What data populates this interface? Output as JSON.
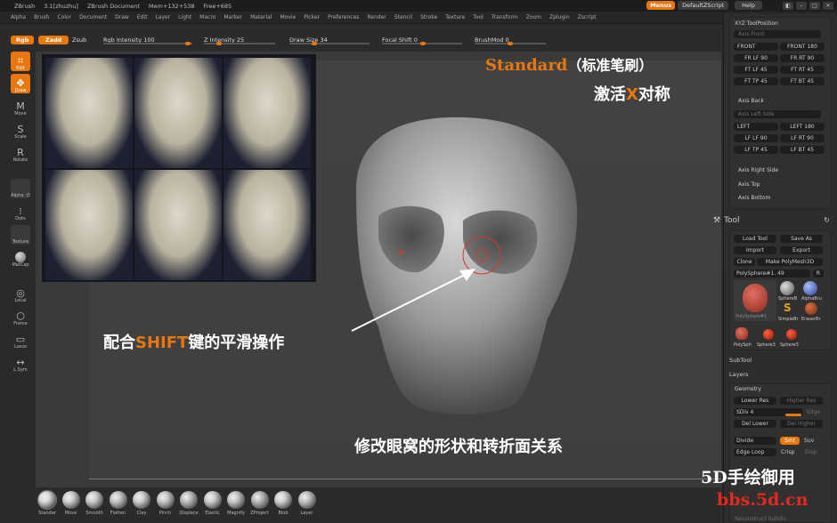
{
  "titlebar": {
    "app": "ZBrush",
    "version": "3.1[zhuzhu]",
    "document": "ZBrush Document",
    "mem": "Mem+132+538",
    "free": "Free+685"
  },
  "top_right": {
    "menus": "Menus",
    "script": "DefaultZScript",
    "help": "Help"
  },
  "menu": [
    "Alpha",
    "Brush",
    "Color",
    "Document",
    "Draw",
    "Edit",
    "Layer",
    "Light",
    "Macro",
    "Marker",
    "Material",
    "Movie",
    "Picker",
    "Preferences",
    "Render",
    "Stencil",
    "Stroke",
    "Texture",
    "Tool",
    "Transform",
    "Zoom",
    "Zplugin",
    "Zscript"
  ],
  "toolbar": {
    "rgb": "Rgb",
    "zadd": "Zadd",
    "zsub": "Zsub",
    "rgb_intensity": "Rgb Intensity 100",
    "z_intensity": "Z Intensity 25",
    "draw_size": "Draw Size 34",
    "focal_shift": "Focal Shift 0",
    "brushmod": "BrushMod 0"
  },
  "shelf": {
    "edit": "Edit",
    "draw": "Draw",
    "move": "Move",
    "scale": "Scale",
    "rotate": "Rotate",
    "alpha": "Alpha :O",
    "dots": "Dots",
    "texture": "Texture",
    "matcap": "MatCap",
    "local": "Local",
    "frame": "Frame",
    "lasso": "Lasso",
    "lsym": "L.Sym"
  },
  "annotations": {
    "brush_en": "Standard",
    "brush_cn": "（标准笔刷）",
    "sym_a": "激活",
    "sym_x": "X",
    "sym_b": "对称",
    "smooth_a": "配合",
    "smooth_shift": "SHIFT",
    "smooth_b": "键的平滑操作",
    "note": "修改眼窝的形状和转折面关系"
  },
  "brushes": [
    "Standar",
    "Move",
    "Smooth",
    "Flatten",
    "Clay",
    "Pinch",
    "Displace",
    "Elastic",
    "Magnify",
    "ZProject",
    "Blob",
    "Layer"
  ],
  "right_panel": {
    "xyz_title": "XYZ ToolPosition",
    "axis_front": "Axis Front",
    "front": "FRONT",
    "front180": "FRONT 180",
    "fr_lf90": "FR LF 90",
    "fr_rt90": "FR RT 90",
    "ft_lf45": "FT LF 45",
    "ft_rt45": "FT RT 45",
    "ft_tp45": "FT TP 45",
    "ft_bt45": "FT BT 45",
    "axis_back": "Axis Back",
    "axis_left_side": "Axis Left Side",
    "left": "LEFT",
    "left180": "LEFT 180",
    "lf_lf90": "LF LF 90",
    "lf_rt90": "LF RT 90",
    "lf_tp45": "LF TP 45",
    "lf_bt45": "LF BT 45",
    "axis_right_side": "Axis Right Side",
    "axis_top": "Axis Top",
    "axis_bottom": "Axis Bottom",
    "tool_title": "Tool",
    "load_tool": "Load Tool",
    "save_as": "Save As",
    "import": "Import",
    "export": "Export",
    "clone": "Clone",
    "make_polymesh": "Make PolyMesh3D",
    "polysphere": "PolySphere#1. 49",
    "r": "R",
    "t_sphereb": "SphereB",
    "t_alphabr": "AlphaBru",
    "t_simplebr": "SimpleBr",
    "t_eraserbr": "EraserBr",
    "t_polysphere1": "PolySphere#1",
    "t_polysph": "PolySph",
    "t_sphere3a": "Sphere3",
    "t_sphere3b": "Sphere3",
    "subtool": "SubTool",
    "layers": "Layers",
    "geometry": "Geometry",
    "lower_res": "Lower Res",
    "higher_res": "Higher Res",
    "sdiv": "SDiv 4",
    "edge": "Edge",
    "del_lower": "Del Lower",
    "del_higher": "Del Higher",
    "divide": "Divide",
    "smt": "Smt",
    "suv": "Suv",
    "edge_loop": "Edge Loop",
    "crisp": "Crisp",
    "disp": "Disp",
    "reconstruct": "Reconstruct Subdiv"
  },
  "watermark": {
    "line1": "5D手绘御用",
    "line2": "bbs.5d.cn"
  }
}
